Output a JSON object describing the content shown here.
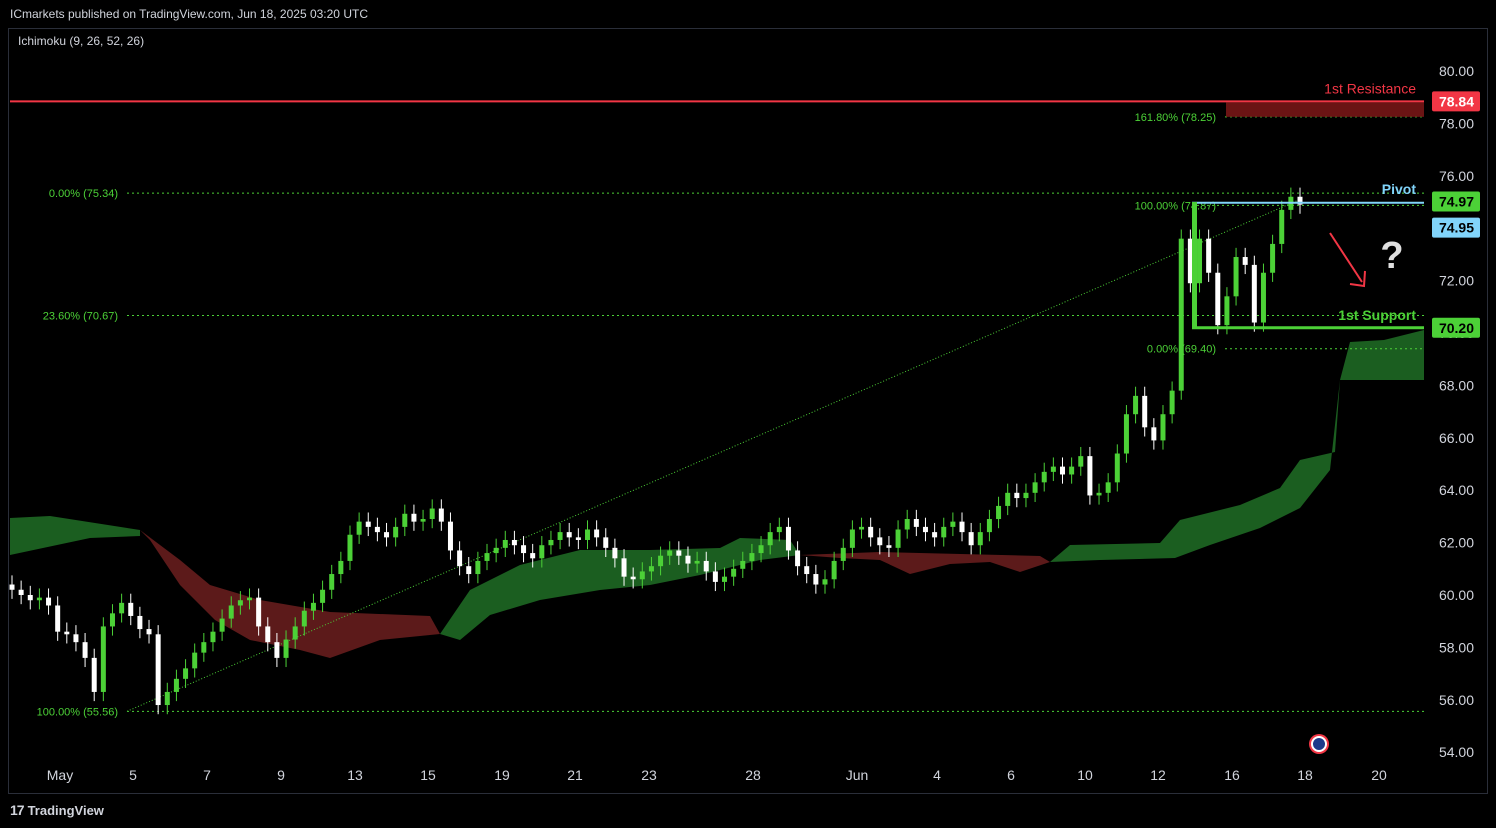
{
  "header": {
    "publisher_line": "ICmarkets published on TradingView.com, Jun 18, 2025 03:20 UTC"
  },
  "indicator": {
    "label": "Ichimoku (9, 26, 52, 26)"
  },
  "footer": {
    "brand": "TradingView",
    "logo": "17"
  },
  "colors": {
    "up": "#4cd137",
    "down": "#ffffff",
    "cloud_bull": "#1b5e20",
    "cloud_bear": "#5c1a1a",
    "resistance": "#f23645",
    "support": "#4cd137",
    "pivot": "#81d4fa",
    "fib": "#4cd137"
  },
  "chart_data": {
    "type": "candlestick",
    "title": "",
    "ylim": [
      54,
      81
    ],
    "y_ticks": [
      "80.00",
      "78.00",
      "76.00",
      "74.00",
      "72.00",
      "70.00",
      "68.00",
      "66.00",
      "64.00",
      "62.00",
      "60.00",
      "58.00",
      "56.00",
      "54.00"
    ],
    "x_ticks": [
      "May",
      "5",
      "7",
      "9",
      "13",
      "15",
      "19",
      "21",
      "23",
      "28",
      "Jun",
      "4",
      "6",
      "10",
      "12",
      "16",
      "18",
      "20"
    ],
    "levels": {
      "resistance": {
        "label": "1st Resistance",
        "value": 78.84,
        "tag": "78.84"
      },
      "pivot": {
        "label": "Pivot",
        "value": 74.97,
        "tag": "74.97",
        "tag2": "74.95"
      },
      "support": {
        "label": "1st Support",
        "value": 70.2,
        "tag": "70.20"
      }
    },
    "fib_left": [
      {
        "label": "0.00% (75.34)",
        "value": 75.34
      },
      {
        "label": "23.60% (70.67)",
        "value": 70.67
      },
      {
        "label": "100.00% (55.56)",
        "value": 55.56
      }
    ],
    "fib_right": [
      {
        "label": "161.80% (78.25)",
        "value": 78.25
      },
      {
        "label": "100.00% (74.87)",
        "value": 74.87
      },
      {
        "label": "0.00% (69.40)",
        "value": 69.4
      }
    ],
    "annotation": "?",
    "candles_close": [
      60.2,
      60.0,
      59.8,
      59.9,
      59.6,
      58.6,
      58.5,
      58.2,
      57.6,
      56.3,
      58.8,
      59.3,
      59.7,
      59.2,
      58.7,
      58.5,
      55.8,
      56.3,
      56.8,
      57.2,
      57.8,
      58.2,
      58.6,
      59.1,
      59.6,
      59.8,
      59.9,
      58.8,
      58.2,
      57.6,
      58.3,
      58.8,
      59.4,
      59.7,
      60.2,
      60.8,
      61.3,
      62.3,
      62.8,
      62.6,
      62.4,
      62.2,
      62.6,
      63.1,
      62.8,
      62.9,
      63.3,
      62.8,
      61.7,
      61.1,
      60.8,
      61.3,
      61.6,
      61.8,
      62.1,
      61.9,
      61.6,
      61.4,
      61.9,
      62.1,
      62.4,
      62.2,
      62.1,
      62.5,
      62.2,
      61.8,
      61.4,
      60.7,
      60.6,
      60.9,
      61.1,
      61.5,
      61.7,
      61.5,
      61.2,
      61.3,
      60.9,
      60.5,
      60.7,
      61.0,
      61.3,
      61.6,
      61.9,
      62.4,
      62.6,
      61.7,
      61.1,
      60.8,
      60.4,
      60.6,
      61.3,
      61.8,
      62.5,
      62.6,
      62.2,
      61.9,
      61.8,
      62.5,
      62.9,
      62.6,
      62.4,
      62.2,
      62.6,
      62.8,
      62.4,
      61.9,
      62.4,
      62.9,
      63.4,
      63.9,
      63.7,
      63.9,
      64.3,
      64.7,
      64.9,
      64.6,
      64.9,
      65.3,
      63.8,
      63.9,
      64.3,
      65.4,
      66.9,
      67.6,
      66.4,
      65.9,
      66.9,
      67.8,
      73.6,
      71.9,
      73.6,
      72.3,
      70.3,
      71.4,
      72.9,
      72.6,
      70.4,
      72.3,
      73.4,
      74.7,
      75.2,
      74.9
    ]
  }
}
